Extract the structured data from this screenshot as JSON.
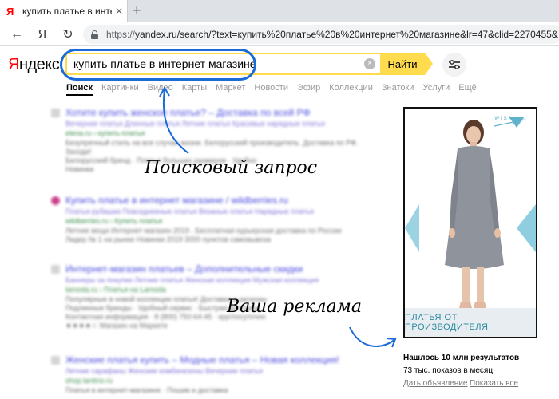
{
  "browser": {
    "tab_favicon": "Я",
    "tab_title": "купить платье в интерне",
    "tab_close": "✕",
    "new_tab": "+",
    "nav_back": "←",
    "nav_home": "Я",
    "nav_reload": "↻",
    "url_proto": "https://",
    "url_rest": "yandex.ru/search/?text=купить%20платье%20в%20интернет%20магазине&lr=47&clid=2270455&"
  },
  "header": {
    "logo_first": "Я",
    "logo_rest": "ндекс",
    "query": "купить платье в интернет магазине",
    "clear_icon": "×",
    "search_button": "Найти"
  },
  "services": [
    "Поиск",
    "Картинки",
    "Видео",
    "Карты",
    "Маркет",
    "Новости",
    "Эфир",
    "Коллекции",
    "Знатоки",
    "Услуги",
    "Ещё"
  ],
  "results": [
    {
      "title": "Хотите купить женское платье? – Доставка по всей РФ",
      "sitelinks": "Вечерние платья   Длинные платья   Летние платья   Красивые нарядные платья",
      "url": "elena.ru › купить-платья",
      "lines": [
        "Безупречный стиль на все случаи жизни. Белорусский производитель. Доставка по РФ.",
        "Заходи!",
        "Белорусский бренд · Платья больших размеров · Удобно",
        "Новинки"
      ]
    },
    {
      "title": "Купить платье в интернет магазине / wildberries.ru",
      "sitelinks": "Платья-рубашки   Повседневные платья   Вязаные платья   Нарядные платья",
      "url": "wildberries.ru › Купить платья",
      "lines": [
        "Летние вещи Интернет-магазин 2019 . Бесплатная курьерская доставка по России",
        "Лидер № 1 на рынке   Новинки 2019   3000 пунктов самовывоза"
      ]
    },
    {
      "title": "Интернет-магазин платьев – Дополнительные скидки",
      "sitelinks": "Баннеры за покупки   Летние платья   Женская коллекция   Мужская коллекция",
      "url": "lamoda.ru › Платья на Lamoda",
      "lines": [
        "Популярные в новой коллекции платья! Доставка в регионы",
        "Подлинные бренды · Удобный сервис · Быстрая доставка",
        "Контактная информация · 8 (800) 750-64-45 · круглосуточно",
        "★★★★☆  Магазин на Маркете"
      ]
    },
    {
      "title": "Женские платья купить – Модные платья – Новая коллекция!",
      "sitelinks": "Летние сарафаны   Женские комбинезоны   Вечерние платья",
      "url": "shop.lantino.ru",
      "lines": [
        "Платья в интернет-магазине · Пошив и доставка"
      ]
    }
  ],
  "annotations": {
    "query_note": "Поисковый запрос",
    "ad_note": "Ваша реклама"
  },
  "ad": {
    "brand": "WISA",
    "footer_text": "ПЛАТЬЯ ОТ ПРОИЗВОДИТЕЛЯ",
    "stats_title": "Нашлось 10 млн результатов",
    "stats_sub": "73 тыс. показов в месяц",
    "link_ad": "Дать объявление",
    "link_all": "Показать все"
  },
  "colors": {
    "yandex_yellow": "#ffdb4d",
    "annotation_blue": "#1a6ad8",
    "link_blue": "#2b2bd8",
    "ad_teal": "#2c8a9e"
  }
}
